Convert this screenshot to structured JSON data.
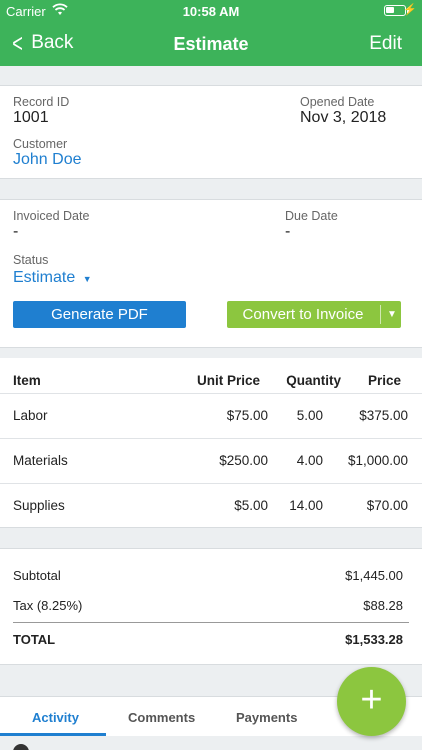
{
  "status_bar": {
    "carrier": "Carrier",
    "time": "10:58 AM",
    "battery_level": 0.45
  },
  "nav": {
    "back_label": "Back",
    "title": "Estimate",
    "edit_label": "Edit"
  },
  "record": {
    "record_id_label": "Record ID",
    "record_id": "1001",
    "opened_label": "Opened Date",
    "opened": "Nov 3, 2018",
    "customer_label": "Customer",
    "customer": "John Doe"
  },
  "details": {
    "invoiced_label": "Invoiced Date",
    "invoiced": "-",
    "due_label": "Due Date",
    "due": "-",
    "status_label": "Status",
    "status": "Estimate",
    "generate_pdf": "Generate PDF",
    "convert_invoice": "Convert to Invoice"
  },
  "table": {
    "headers": [
      "Item",
      "Unit Price",
      "Quantity",
      "Price"
    ],
    "rows": [
      [
        "Labor",
        "$75.00",
        "5.00",
        "$375.00"
      ],
      [
        "Materials",
        "$250.00",
        "4.00",
        "$1,000.00"
      ],
      [
        "Supplies",
        "$5.00",
        "14.00",
        "$70.00"
      ]
    ]
  },
  "totals": {
    "subtotal_label": "Subtotal",
    "subtotal": "$1,445.00",
    "tax_label": "Tax (8.25%)",
    "tax": "$88.28",
    "total_label": "TOTAL",
    "total": "$1,533.28"
  },
  "tabs": [
    "Activity",
    "Comments",
    "Payments"
  ],
  "fab_label": "+",
  "colors": {
    "brand_green": "#3db35a",
    "link_blue": "#1f7fd0",
    "accent_lime": "#8cc63f"
  }
}
